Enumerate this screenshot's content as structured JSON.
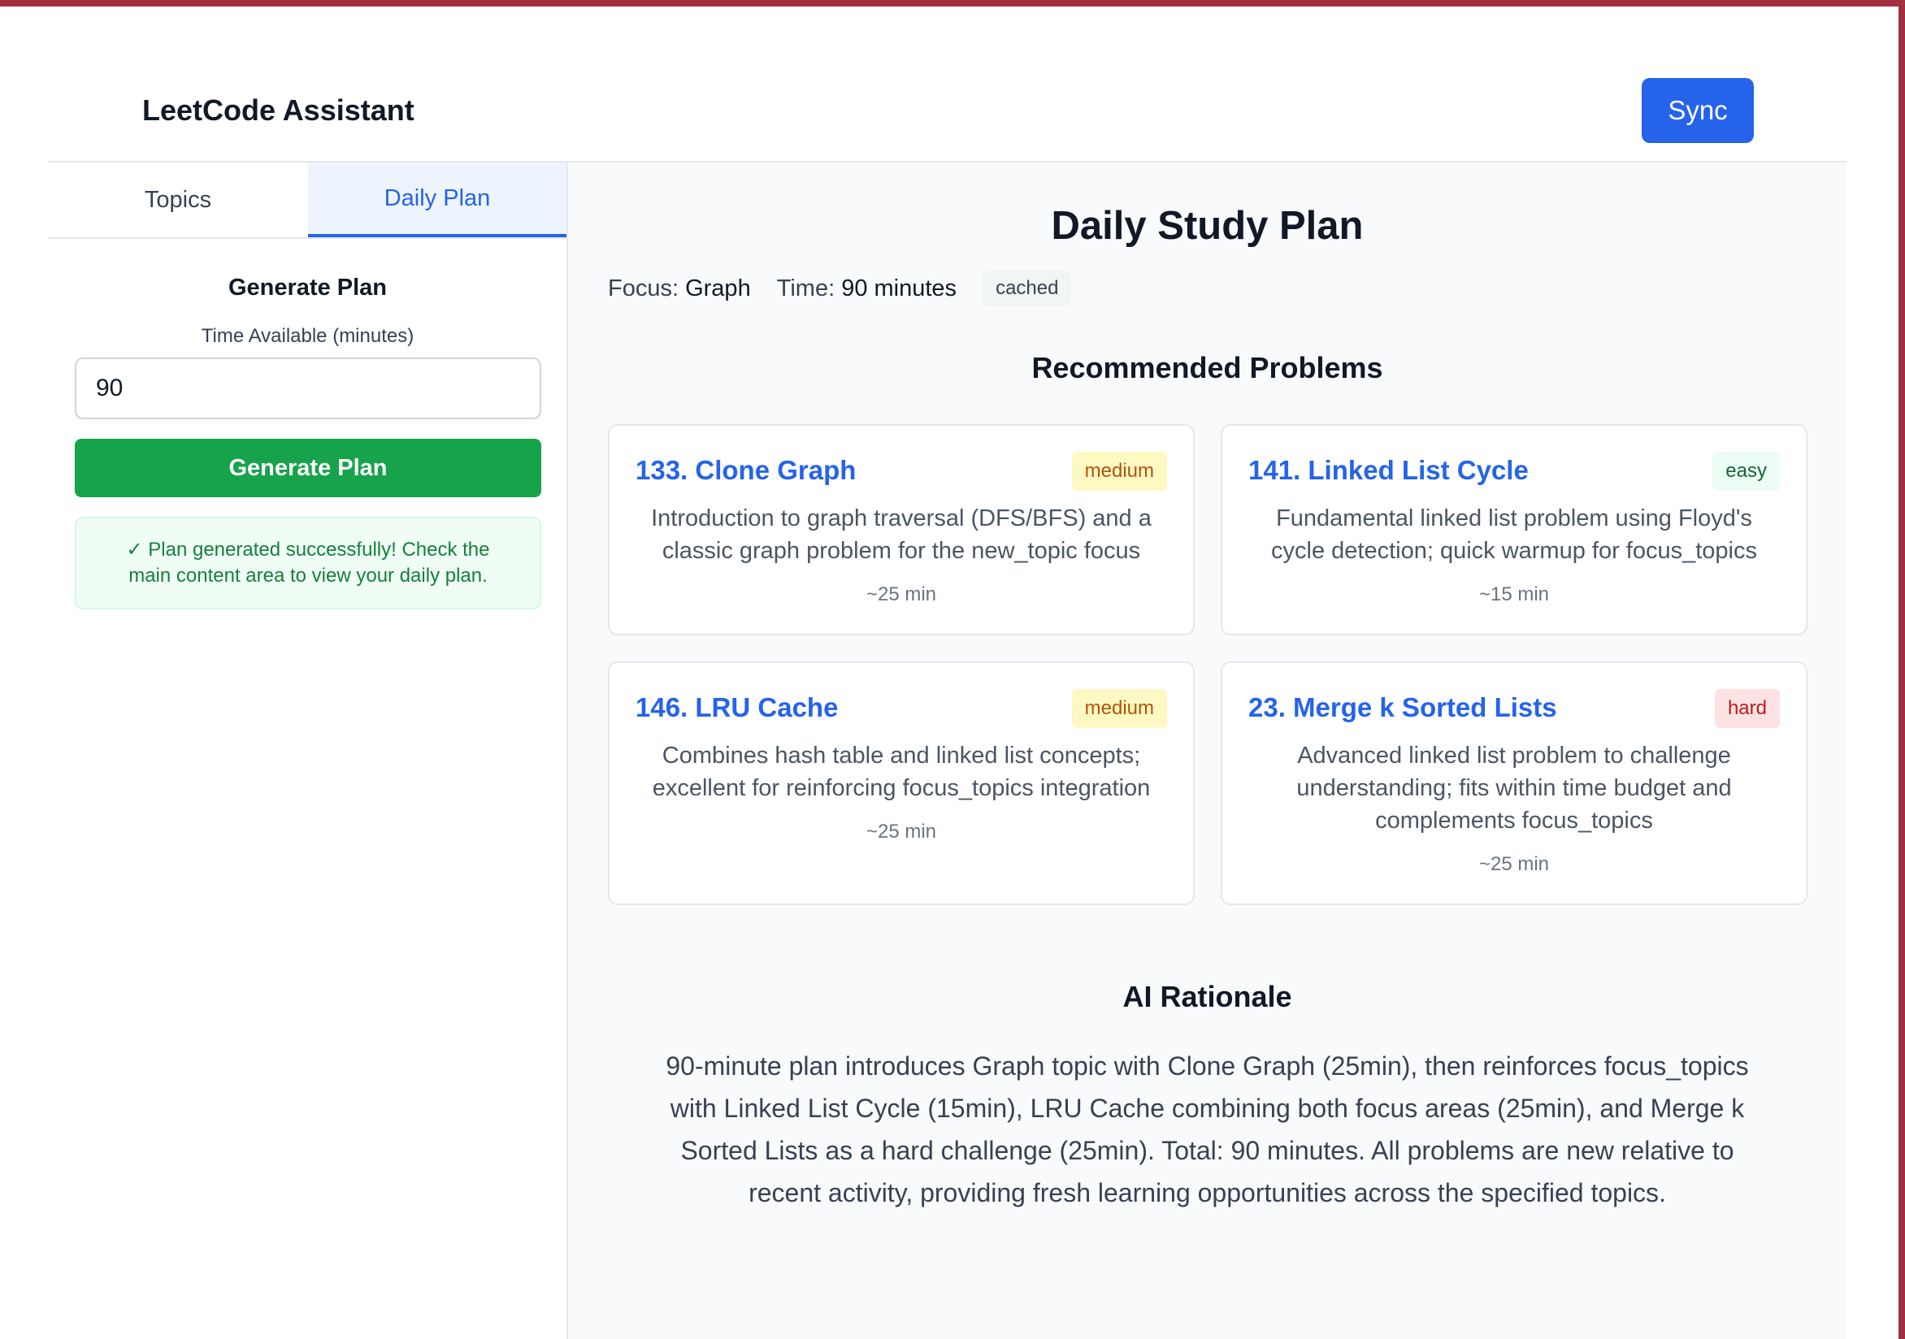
{
  "app": {
    "title": "LeetCode Assistant",
    "sync_label": "Sync"
  },
  "sidebar": {
    "tabs": [
      {
        "label": "Topics",
        "active": false
      },
      {
        "label": "Daily Plan",
        "active": true
      }
    ],
    "section_title": "Generate Plan",
    "time_label": "Time Available (minutes)",
    "time_value": "90",
    "generate_label": "Generate Plan",
    "success_message": "✓ Plan generated successfully! Check the main content area to view your daily plan."
  },
  "plan": {
    "title": "Daily Study Plan",
    "focus_label": "Focus:",
    "focus_value": "Graph",
    "time_label": "Time:",
    "time_value": "90 minutes",
    "status_badge": "cached",
    "recommended_title": "Recommended Problems",
    "problems": [
      {
        "title": "133. Clone Graph",
        "difficulty": "medium",
        "description": "Introduction to graph traversal (DFS/BFS) and a classic graph problem for the new_topic focus",
        "time": "~25 min"
      },
      {
        "title": "141. Linked List Cycle",
        "difficulty": "easy",
        "description": "Fundamental linked list problem using Floyd's cycle detection; quick warmup for focus_topics",
        "time": "~15 min"
      },
      {
        "title": "146. LRU Cache",
        "difficulty": "medium",
        "description": "Combines hash table and linked list concepts; excellent for reinforcing focus_topics integration",
        "time": "~25 min"
      },
      {
        "title": "23. Merge k Sorted Lists",
        "difficulty": "hard",
        "description": "Advanced linked list problem to challenge understanding; fits within time budget and complements focus_topics",
        "time": "~25 min"
      }
    ],
    "rationale_title": "AI Rationale",
    "rationale_text": "90-minute plan introduces Graph topic with Clone Graph (25min), then reinforces focus_topics with Linked List Cycle (15min), LRU Cache combining both focus areas (25min), and Merge k Sorted Lists as a hard challenge (25min). Total: 90 minutes. All problems are new relative to recent activity, providing fresh learning opportunities across the specified topics."
  },
  "colors": {
    "accent": "#2563eb",
    "success": "#16a34a",
    "window_border": "#a33040"
  }
}
